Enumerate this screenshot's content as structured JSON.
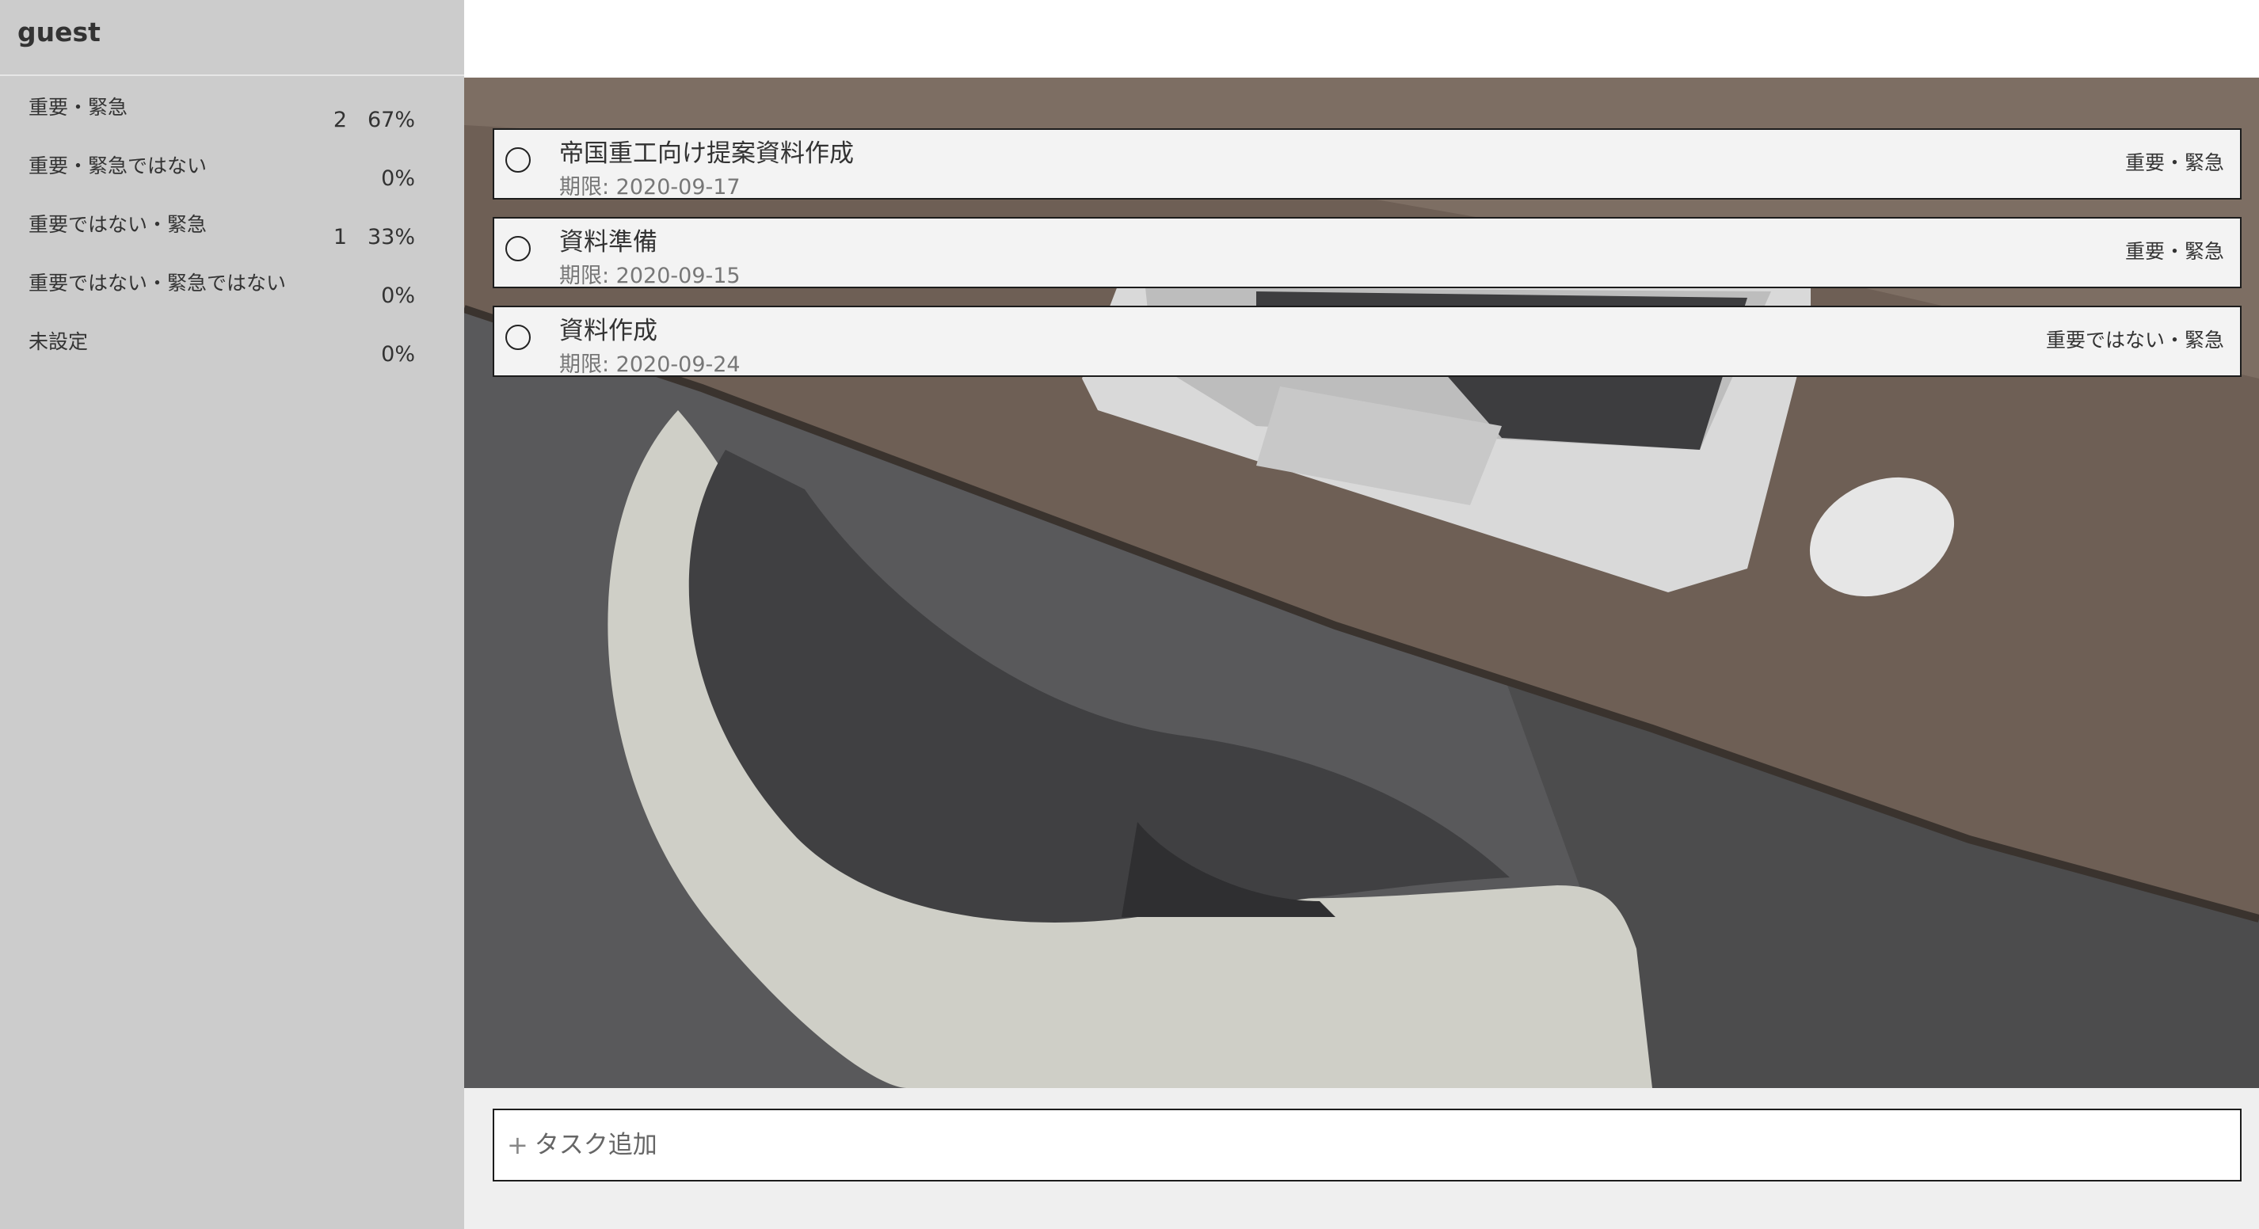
{
  "user": {
    "name": "guest"
  },
  "categories": [
    {
      "label": "重要・緊急",
      "count": "2",
      "percent": "67%"
    },
    {
      "label": "重要・緊急ではない",
      "count": "",
      "percent": "0%"
    },
    {
      "label": "重要ではない・緊急",
      "count": "1",
      "percent": "33%"
    },
    {
      "label": "重要ではない・緊急ではない",
      "count": "",
      "percent": "0%"
    },
    {
      "label": "未設定",
      "count": "",
      "percent": "0%"
    }
  ],
  "tasks": [
    {
      "title": "帝国重工向け提案資料作成",
      "due": "期限: 2020-09-17",
      "priority": "重要・緊急"
    },
    {
      "title": "資料準備",
      "due": "期限: 2020-09-15",
      "priority": "重要・緊急"
    },
    {
      "title": "資料作成",
      "due": "期限: 2020-09-24",
      "priority": "重要ではない・緊急"
    }
  ],
  "add_task": {
    "icon": "+",
    "placeholder": "タスク追加"
  },
  "colors": {
    "sidebar_bg": "#cccccc",
    "main_bg": "#efefef",
    "task_bg": "#f3f3f3",
    "border": "#1c1c1c"
  }
}
